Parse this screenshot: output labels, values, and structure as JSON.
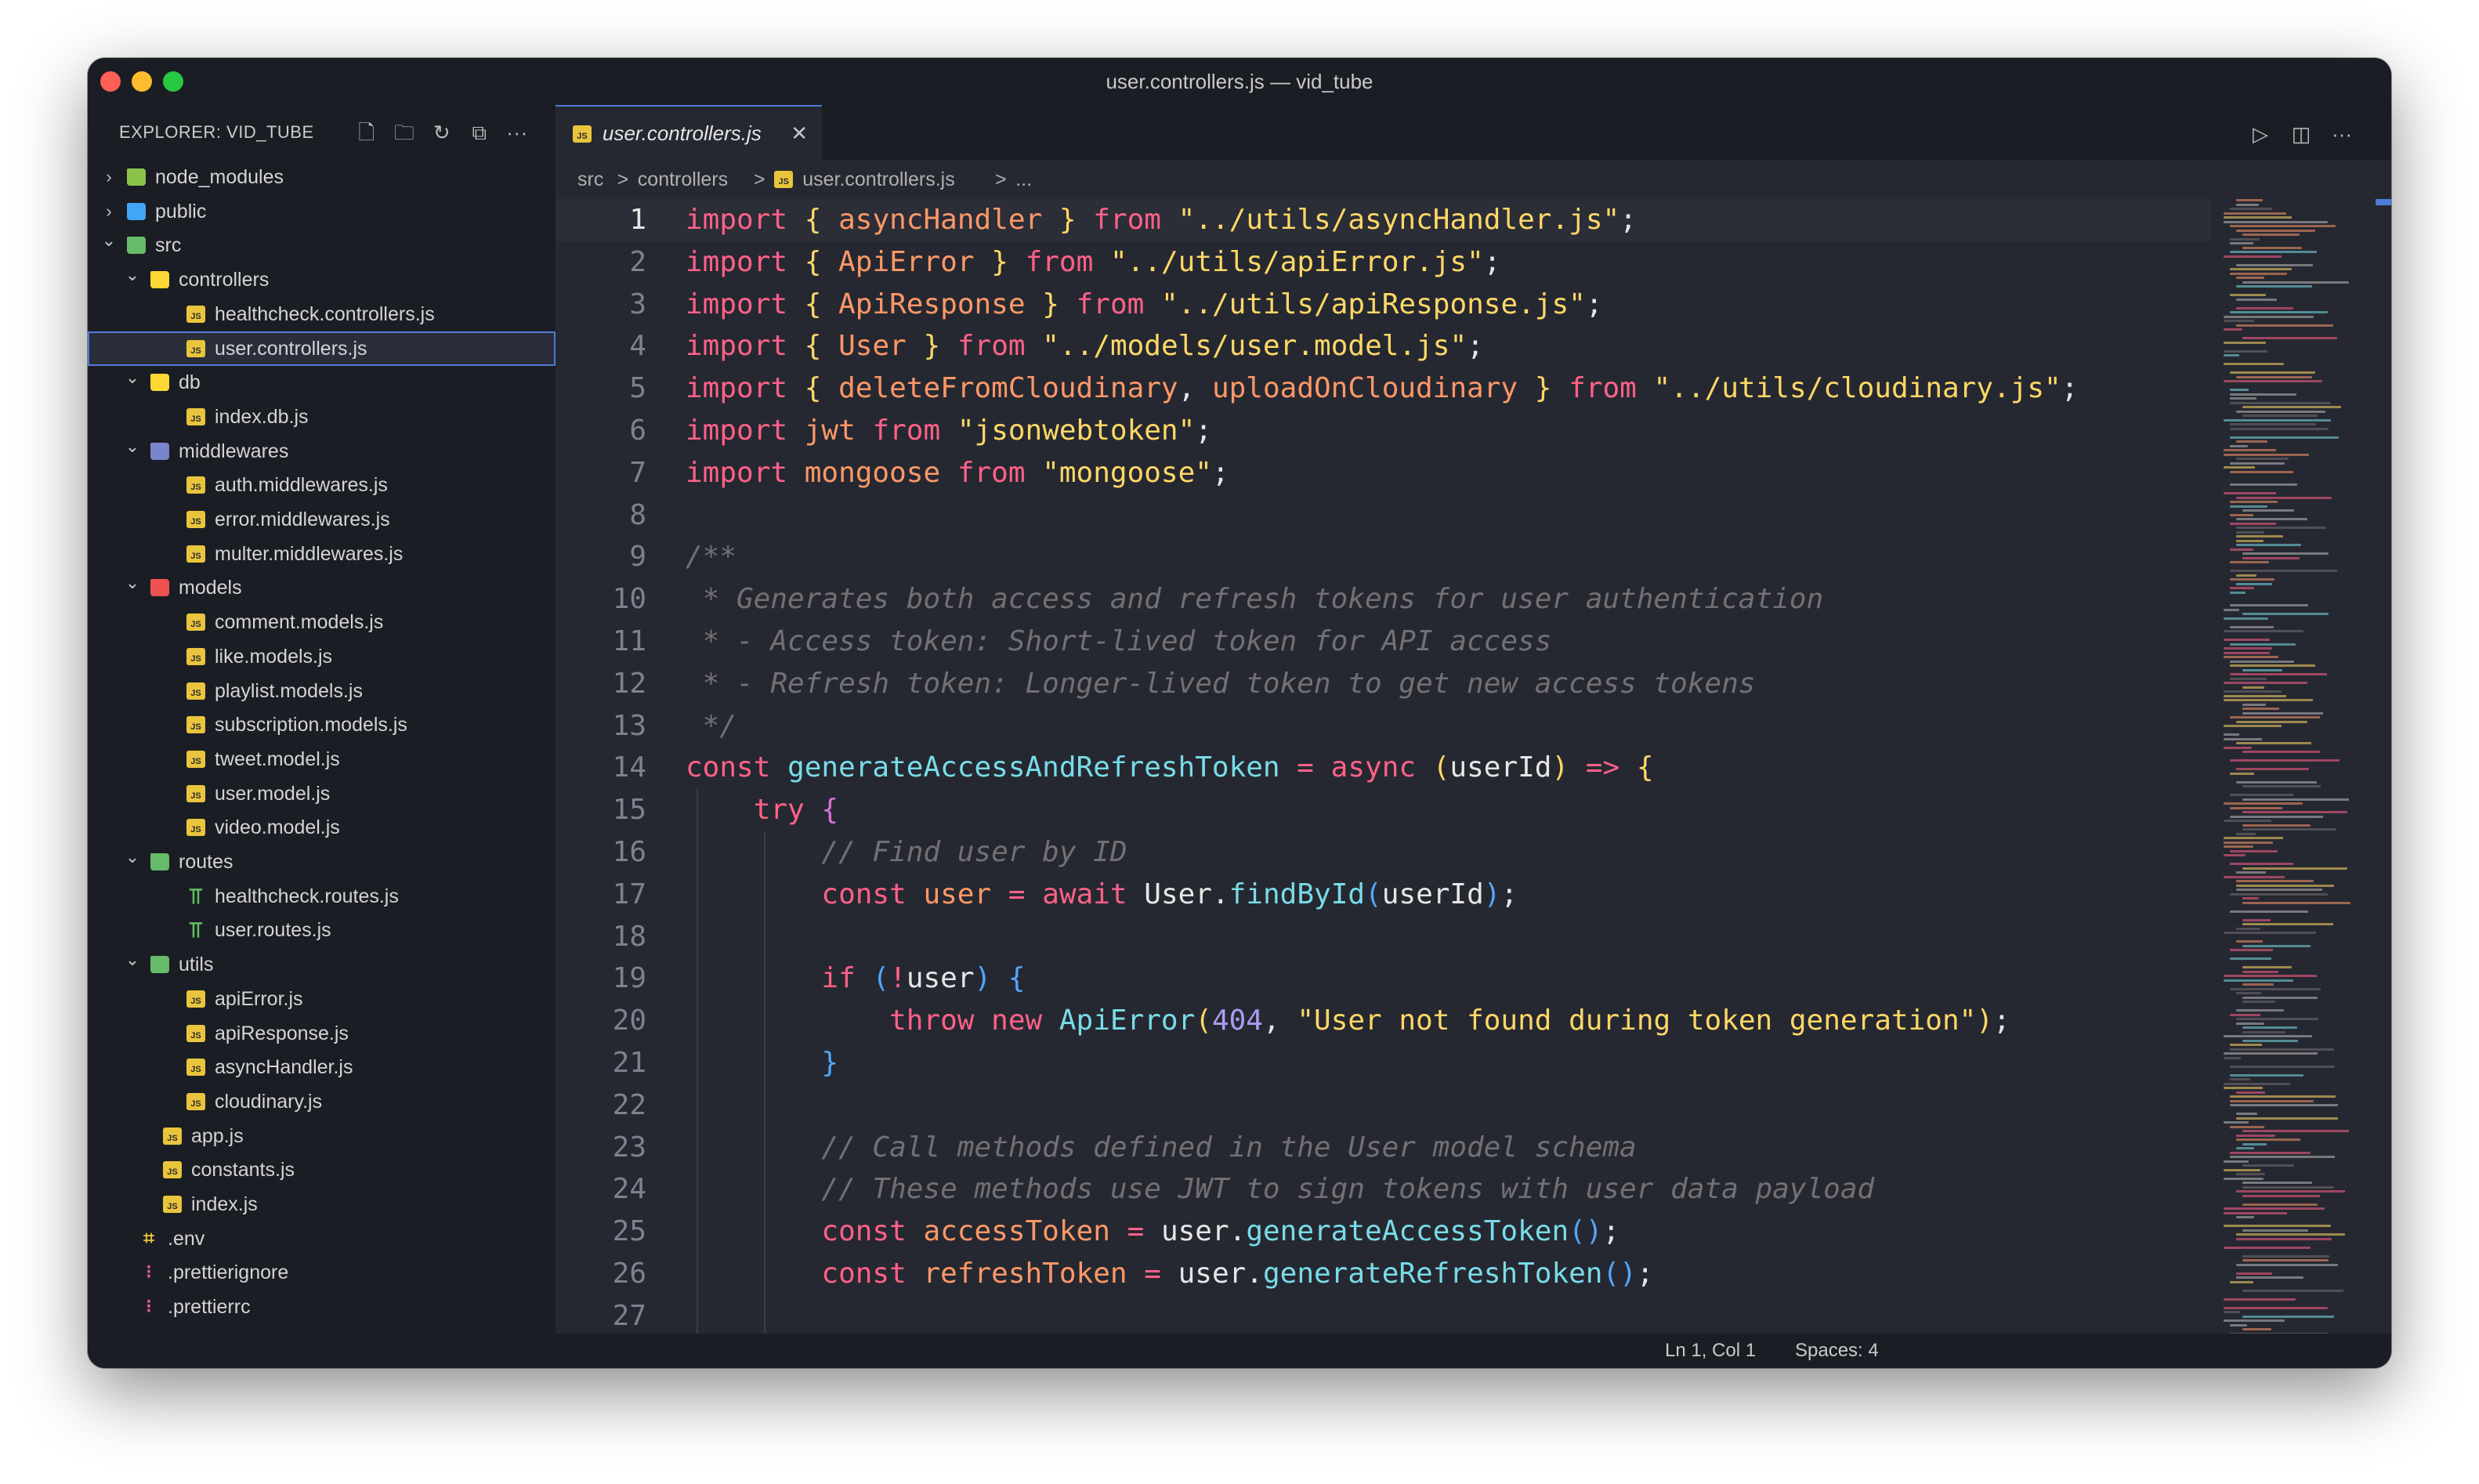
{
  "window": {
    "title": "user.controllers.js — vid_tube"
  },
  "sidebar": {
    "header": "EXPLORER: VID_TUBE",
    "actions": [
      {
        "name": "new-file-icon",
        "glyph": "🗋"
      },
      {
        "name": "new-folder-icon",
        "glyph": "🗀"
      },
      {
        "name": "refresh-icon",
        "glyph": "↻"
      },
      {
        "name": "collapse-all-icon",
        "glyph": "⧉"
      },
      {
        "name": "more-icon",
        "glyph": "···"
      }
    ],
    "tree": [
      {
        "label": "node_modules",
        "depth": 0,
        "kind": "folder",
        "expanded": false,
        "color": "#8bc34a"
      },
      {
        "label": "public",
        "depth": 0,
        "kind": "folder",
        "expanded": false,
        "color": "#42a5f5"
      },
      {
        "label": "src",
        "depth": 0,
        "kind": "folder",
        "expanded": true,
        "color": "#66bb6a"
      },
      {
        "label": "controllers",
        "depth": 1,
        "kind": "folder",
        "expanded": true,
        "color": "#fdd835"
      },
      {
        "label": "healthcheck.controllers.js",
        "depth": 2,
        "kind": "js"
      },
      {
        "label": "user.controllers.js",
        "depth": 2,
        "kind": "js",
        "selected": true
      },
      {
        "label": "db",
        "depth": 1,
        "kind": "folder",
        "expanded": true,
        "color": "#fdd835"
      },
      {
        "label": "index.db.js",
        "depth": 2,
        "kind": "js"
      },
      {
        "label": "middlewares",
        "depth": 1,
        "kind": "folder",
        "expanded": true,
        "color": "#7986cb"
      },
      {
        "label": "auth.middlewares.js",
        "depth": 2,
        "kind": "js"
      },
      {
        "label": "error.middlewares.js",
        "depth": 2,
        "kind": "js"
      },
      {
        "label": "multer.middlewares.js",
        "depth": 2,
        "kind": "js"
      },
      {
        "label": "models",
        "depth": 1,
        "kind": "folder",
        "expanded": true,
        "color": "#ef5350"
      },
      {
        "label": "comment.models.js",
        "depth": 2,
        "kind": "js"
      },
      {
        "label": "like.models.js",
        "depth": 2,
        "kind": "js"
      },
      {
        "label": "playlist.models.js",
        "depth": 2,
        "kind": "js"
      },
      {
        "label": "subscription.models.js",
        "depth": 2,
        "kind": "js"
      },
      {
        "label": "tweet.model.js",
        "depth": 2,
        "kind": "js"
      },
      {
        "label": "user.model.js",
        "depth": 2,
        "kind": "js"
      },
      {
        "label": "video.model.js",
        "depth": 2,
        "kind": "js"
      },
      {
        "label": "routes",
        "depth": 1,
        "kind": "folder",
        "expanded": true,
        "color": "#66bb6a"
      },
      {
        "label": "healthcheck.routes.js",
        "depth": 2,
        "kind": "route"
      },
      {
        "label": "user.routes.js",
        "depth": 2,
        "kind": "route"
      },
      {
        "label": "utils",
        "depth": 1,
        "kind": "folder",
        "expanded": true,
        "color": "#66bb6a"
      },
      {
        "label": "apiError.js",
        "depth": 2,
        "kind": "js"
      },
      {
        "label": "apiResponse.js",
        "depth": 2,
        "kind": "js"
      },
      {
        "label": "asyncHandler.js",
        "depth": 2,
        "kind": "js"
      },
      {
        "label": "cloudinary.js",
        "depth": 2,
        "kind": "js"
      },
      {
        "label": "app.js",
        "depth": 1,
        "kind": "js"
      },
      {
        "label": "constants.js",
        "depth": 1,
        "kind": "js"
      },
      {
        "label": "index.js",
        "depth": 1,
        "kind": "js"
      },
      {
        "label": ".env",
        "depth": 0,
        "kind": "env"
      },
      {
        "label": ".prettierignore",
        "depth": 0,
        "kind": "pretty"
      },
      {
        "label": ".prettierrc",
        "depth": 0,
        "kind": "pretty"
      }
    ]
  },
  "editor": {
    "tab": {
      "label": "user.controllers.js",
      "close": "✕"
    },
    "actions": [
      {
        "name": "run-icon",
        "glyph": "▷"
      },
      {
        "name": "split-editor-icon",
        "glyph": "◫"
      },
      {
        "name": "more-icon",
        "glyph": "···"
      }
    ],
    "breadcrumbs": [
      "src",
      ">",
      "controllers",
      ">",
      "user.controllers.js",
      ">",
      "..."
    ],
    "current_line": 1,
    "lines": [
      [
        [
          "kw",
          "import"
        ],
        [
          "punc",
          " "
        ],
        [
          "bracket1",
          "{"
        ],
        [
          "punc",
          " "
        ],
        [
          "var",
          "asyncHandler"
        ],
        [
          "punc",
          " "
        ],
        [
          "bracket1",
          "}"
        ],
        [
          "punc",
          " "
        ],
        [
          "kw",
          "from"
        ],
        [
          "punc",
          " "
        ],
        [
          "str",
          "\"../utils/asyncHandler.js\""
        ],
        [
          "punc",
          ";"
        ]
      ],
      [
        [
          "kw",
          "import"
        ],
        [
          "punc",
          " "
        ],
        [
          "bracket1",
          "{"
        ],
        [
          "punc",
          " "
        ],
        [
          "var",
          "ApiError"
        ],
        [
          "punc",
          " "
        ],
        [
          "bracket1",
          "}"
        ],
        [
          "punc",
          " "
        ],
        [
          "kw",
          "from"
        ],
        [
          "punc",
          " "
        ],
        [
          "str",
          "\"../utils/apiError.js\""
        ],
        [
          "punc",
          ";"
        ]
      ],
      [
        [
          "kw",
          "import"
        ],
        [
          "punc",
          " "
        ],
        [
          "bracket1",
          "{"
        ],
        [
          "punc",
          " "
        ],
        [
          "var",
          "ApiResponse"
        ],
        [
          "punc",
          " "
        ],
        [
          "bracket1",
          "}"
        ],
        [
          "punc",
          " "
        ],
        [
          "kw",
          "from"
        ],
        [
          "punc",
          " "
        ],
        [
          "str",
          "\"../utils/apiResponse.js\""
        ],
        [
          "punc",
          ";"
        ]
      ],
      [
        [
          "kw",
          "import"
        ],
        [
          "punc",
          " "
        ],
        [
          "bracket1",
          "{"
        ],
        [
          "punc",
          " "
        ],
        [
          "var",
          "User"
        ],
        [
          "punc",
          " "
        ],
        [
          "bracket1",
          "}"
        ],
        [
          "punc",
          " "
        ],
        [
          "kw",
          "from"
        ],
        [
          "punc",
          " "
        ],
        [
          "str",
          "\"../models/user.model.js\""
        ],
        [
          "punc",
          ";"
        ]
      ],
      [
        [
          "kw",
          "import"
        ],
        [
          "punc",
          " "
        ],
        [
          "bracket1",
          "{"
        ],
        [
          "punc",
          " "
        ],
        [
          "var",
          "deleteFromCloudinary"
        ],
        [
          "punc",
          ", "
        ],
        [
          "var",
          "uploadOnCloudinary"
        ],
        [
          "punc",
          " "
        ],
        [
          "bracket1",
          "}"
        ],
        [
          "punc",
          " "
        ],
        [
          "kw",
          "from"
        ],
        [
          "punc",
          " "
        ],
        [
          "str",
          "\"../utils/cloudinary.js\""
        ],
        [
          "punc",
          ";"
        ]
      ],
      [
        [
          "kw",
          "import"
        ],
        [
          "punc",
          " "
        ],
        [
          "var",
          "jwt"
        ],
        [
          "punc",
          " "
        ],
        [
          "kw",
          "from"
        ],
        [
          "punc",
          " "
        ],
        [
          "str",
          "\"jsonwebtoken\""
        ],
        [
          "punc",
          ";"
        ]
      ],
      [
        [
          "kw",
          "import"
        ],
        [
          "punc",
          " "
        ],
        [
          "var",
          "mongoose"
        ],
        [
          "punc",
          " "
        ],
        [
          "kw",
          "from"
        ],
        [
          "punc",
          " "
        ],
        [
          "str",
          "\"mongoose\""
        ],
        [
          "punc",
          ";"
        ]
      ],
      [],
      [
        [
          "cm",
          "/**"
        ]
      ],
      [
        [
          "cm",
          " * Generates both access and refresh tokens for user authentication"
        ]
      ],
      [
        [
          "cm",
          " * - Access token: Short-lived token for API access"
        ]
      ],
      [
        [
          "cm",
          " * - Refresh token: Longer-lived token to get new access tokens"
        ]
      ],
      [
        [
          "cm",
          " */"
        ]
      ],
      [
        [
          "kw",
          "const"
        ],
        [
          "punc",
          " "
        ],
        [
          "fn",
          "generateAccessAndRefreshToken"
        ],
        [
          "punc",
          " "
        ],
        [
          "kw",
          "="
        ],
        [
          "punc",
          " "
        ],
        [
          "kw",
          "async"
        ],
        [
          "punc",
          " "
        ],
        [
          "bracket1",
          "("
        ],
        [
          "plain",
          "userId"
        ],
        [
          "bracket1",
          ")"
        ],
        [
          "punc",
          " "
        ],
        [
          "kw",
          "=>"
        ],
        [
          "punc",
          " "
        ],
        [
          "bracket1",
          "{"
        ]
      ],
      [
        [
          "punc",
          "    "
        ],
        [
          "kw",
          "try"
        ],
        [
          "punc",
          " "
        ],
        [
          "bracket2",
          "{"
        ]
      ],
      [
        [
          "punc",
          "        "
        ],
        [
          "cm",
          "// Find user by ID"
        ]
      ],
      [
        [
          "punc",
          "        "
        ],
        [
          "kw",
          "const"
        ],
        [
          "punc",
          " "
        ],
        [
          "var",
          "user"
        ],
        [
          "punc",
          " "
        ],
        [
          "kw",
          "="
        ],
        [
          "punc",
          " "
        ],
        [
          "kw",
          "await"
        ],
        [
          "punc",
          " "
        ],
        [
          "plain",
          "User."
        ],
        [
          "fn",
          "findById"
        ],
        [
          "bracket3",
          "("
        ],
        [
          "plain",
          "userId"
        ],
        [
          "bracket3",
          ")"
        ],
        [
          "punc",
          ";"
        ]
      ],
      [],
      [
        [
          "punc",
          "        "
        ],
        [
          "kw",
          "if"
        ],
        [
          "punc",
          " "
        ],
        [
          "bracket3",
          "("
        ],
        [
          "kw",
          "!"
        ],
        [
          "plain",
          "user"
        ],
        [
          "bracket3",
          ")"
        ],
        [
          "punc",
          " "
        ],
        [
          "bracket3",
          "{"
        ]
      ],
      [
        [
          "punc",
          "            "
        ],
        [
          "kw",
          "throw"
        ],
        [
          "punc",
          " "
        ],
        [
          "kw",
          "new"
        ],
        [
          "punc",
          " "
        ],
        [
          "fn",
          "ApiError"
        ],
        [
          "bracket1",
          "("
        ],
        [
          "num",
          "404"
        ],
        [
          "punc",
          ", "
        ],
        [
          "str",
          "\"User not found during token generation\""
        ],
        [
          "bracket1",
          ")"
        ],
        [
          "punc",
          ";"
        ]
      ],
      [
        [
          "punc",
          "        "
        ],
        [
          "bracket3",
          "}"
        ]
      ],
      [],
      [
        [
          "punc",
          "        "
        ],
        [
          "cm",
          "// Call methods defined in the User model schema"
        ]
      ],
      [
        [
          "punc",
          "        "
        ],
        [
          "cm",
          "// These methods use JWT to sign tokens with user data payload"
        ]
      ],
      [
        [
          "punc",
          "        "
        ],
        [
          "kw",
          "const"
        ],
        [
          "punc",
          " "
        ],
        [
          "var",
          "accessToken"
        ],
        [
          "punc",
          " "
        ],
        [
          "kw",
          "="
        ],
        [
          "punc",
          " "
        ],
        [
          "plain",
          "user."
        ],
        [
          "fn",
          "generateAccessToken"
        ],
        [
          "bracket3",
          "()"
        ],
        [
          "punc",
          ";"
        ]
      ],
      [
        [
          "punc",
          "        "
        ],
        [
          "kw",
          "const"
        ],
        [
          "punc",
          " "
        ],
        [
          "var",
          "refreshToken"
        ],
        [
          "punc",
          " "
        ],
        [
          "kw",
          "="
        ],
        [
          "punc",
          " "
        ],
        [
          "plain",
          "user."
        ],
        [
          "fn",
          "generateRefreshToken"
        ],
        [
          "bracket3",
          "()"
        ],
        [
          "punc",
          ";"
        ]
      ],
      []
    ]
  },
  "statusbar": {
    "position": "Ln 1, Col 1",
    "indent": "Spaces: 4"
  }
}
